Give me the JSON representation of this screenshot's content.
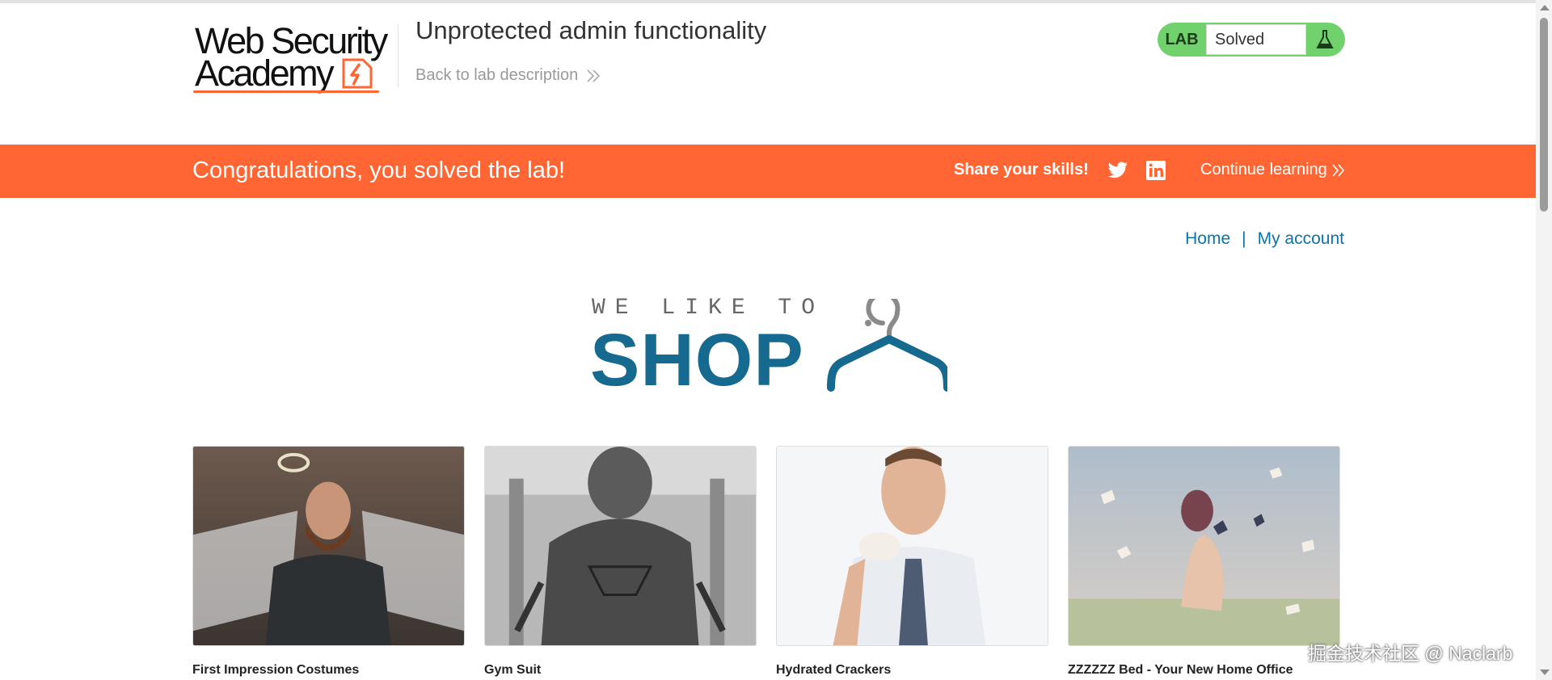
{
  "header": {
    "logo_line1": "Web Security",
    "logo_line2": "Academy",
    "lab_title": "Unprotected admin functionality",
    "back_link": "Back to lab description",
    "lab_badge": {
      "label": "LAB",
      "status": "Solved",
      "color": "#70d16d"
    }
  },
  "banner": {
    "message": "Congratulations, you solved the lab!",
    "share_label": "Share your skills!",
    "share_icons": [
      "twitter-icon",
      "linkedin-icon"
    ],
    "continue_label": "Continue learning",
    "color": "#ff6633"
  },
  "nav": {
    "home": "Home",
    "separator": "|",
    "account": "My account"
  },
  "shop_logo": {
    "tagline": "WE LIKE TO",
    "word": "SHOP",
    "icon": "hanger-icon"
  },
  "products": [
    {
      "name": "First Impression Costumes",
      "image": "angel-costume-photo"
    },
    {
      "name": "Gym Suit",
      "image": "dog-gym-photo"
    },
    {
      "name": "Hydrated Crackers",
      "image": "man-eating-cracker-photo"
    },
    {
      "name": "ZZZZZZ Bed - Your New Home Office",
      "image": "floating-books-bed-photo"
    }
  ],
  "watermark": "掘金技术社区 @ Naclarb",
  "colors": {
    "accent": "#ff6633",
    "link": "#0b74a8",
    "shop_blue": "#166a8f"
  }
}
